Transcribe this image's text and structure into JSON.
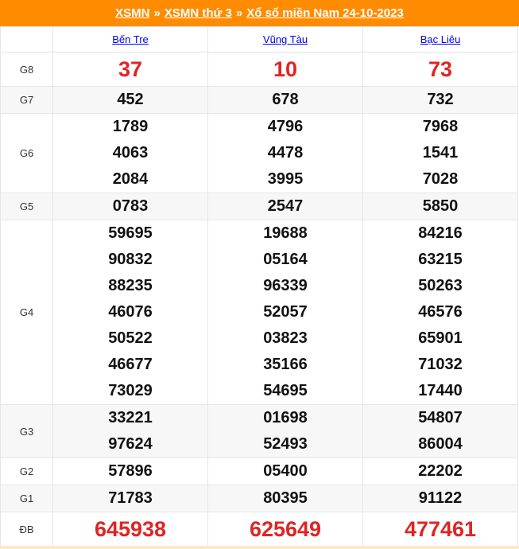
{
  "breadcrumb": {
    "items": [
      "XSMN",
      "XSMN thứ 3",
      "Xổ số miền Nam 24-10-2023"
    ],
    "separator": "»"
  },
  "provinces": [
    "Bến Tre",
    "Vũng Tàu",
    "Bạc Liêu"
  ],
  "prizes": [
    {
      "label": "G8",
      "values": [
        [
          "37"
        ],
        [
          "10"
        ],
        [
          "73"
        ]
      ]
    },
    {
      "label": "G7",
      "values": [
        [
          "452"
        ],
        [
          "678"
        ],
        [
          "732"
        ]
      ]
    },
    {
      "label": "G6",
      "values": [
        [
          "1789",
          "4063",
          "2084"
        ],
        [
          "4796",
          "4478",
          "3995"
        ],
        [
          "7968",
          "1541",
          "7028"
        ]
      ]
    },
    {
      "label": "G5",
      "values": [
        [
          "0783"
        ],
        [
          "2547"
        ],
        [
          "5850"
        ]
      ]
    },
    {
      "label": "G4",
      "values": [
        [
          "59695",
          "90832",
          "88235",
          "46076",
          "50522",
          "46677",
          "73029"
        ],
        [
          "19688",
          "05164",
          "96339",
          "52057",
          "03823",
          "35166",
          "54695"
        ],
        [
          "84216",
          "63215",
          "50263",
          "46576",
          "65901",
          "71032",
          "17440"
        ]
      ]
    },
    {
      "label": "G3",
      "values": [
        [
          "33221",
          "97624"
        ],
        [
          "01698",
          "52493"
        ],
        [
          "54807",
          "86004"
        ]
      ]
    },
    {
      "label": "G2",
      "values": [
        [
          "57896"
        ],
        [
          "05400"
        ],
        [
          "22202"
        ]
      ]
    },
    {
      "label": "G1",
      "values": [
        [
          "71783"
        ],
        [
          "80395"
        ],
        [
          "91122"
        ]
      ]
    },
    {
      "label": "ĐB",
      "values": [
        [
          "645938"
        ],
        [
          "625649"
        ],
        [
          "477461"
        ]
      ]
    }
  ],
  "colors": {
    "header_bg": "#ff8c00",
    "special_red": "#e02424",
    "link_blue": "#0000ee"
  }
}
